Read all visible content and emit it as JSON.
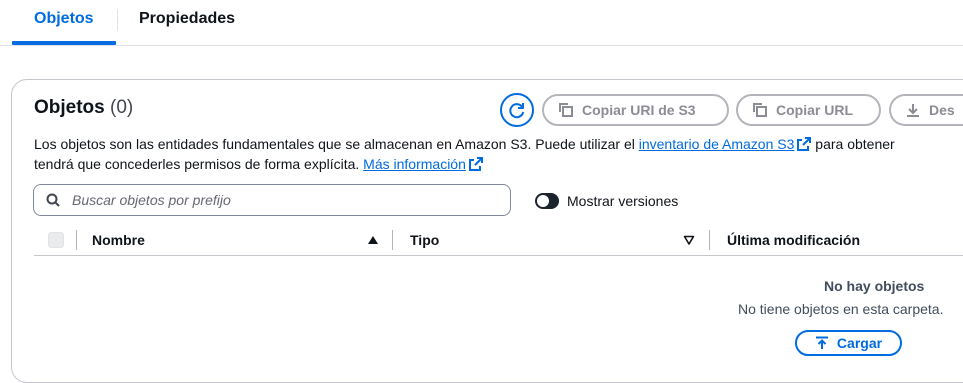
{
  "tabs": [
    {
      "label": "Objetos",
      "active": true
    },
    {
      "label": "Propiedades",
      "active": false
    }
  ],
  "header": {
    "title": "Objetos",
    "count": "(0)",
    "buttons": {
      "refresh_icon": "refresh-icon",
      "copy_uri": "Copiar URI de S3",
      "copy_url": "Copiar URL",
      "download": "Des"
    }
  },
  "description": {
    "part1": "Los objetos son las entidades fundamentales que se almacenan en Amazon S3. Puede utilizar el ",
    "link1": "inventario de Amazon S3",
    "part2": " para obtener",
    "line2": "tendrá que concederles permisos de forma explícita. ",
    "link2": "Más información"
  },
  "search": {
    "placeholder": "Buscar objetos por prefijo",
    "value": ""
  },
  "toggle": {
    "label": "Mostrar versiones",
    "on": false
  },
  "table": {
    "columns": [
      "Nombre",
      "Tipo",
      "Última modificación"
    ]
  },
  "empty_state": {
    "title": "No hay objetos",
    "text": "No tiene objetos en esta carpeta.",
    "upload_label": "Cargar"
  },
  "colors": {
    "accent": "#006ce0",
    "disabled": "#8c8c94",
    "text": "#0f141a"
  }
}
